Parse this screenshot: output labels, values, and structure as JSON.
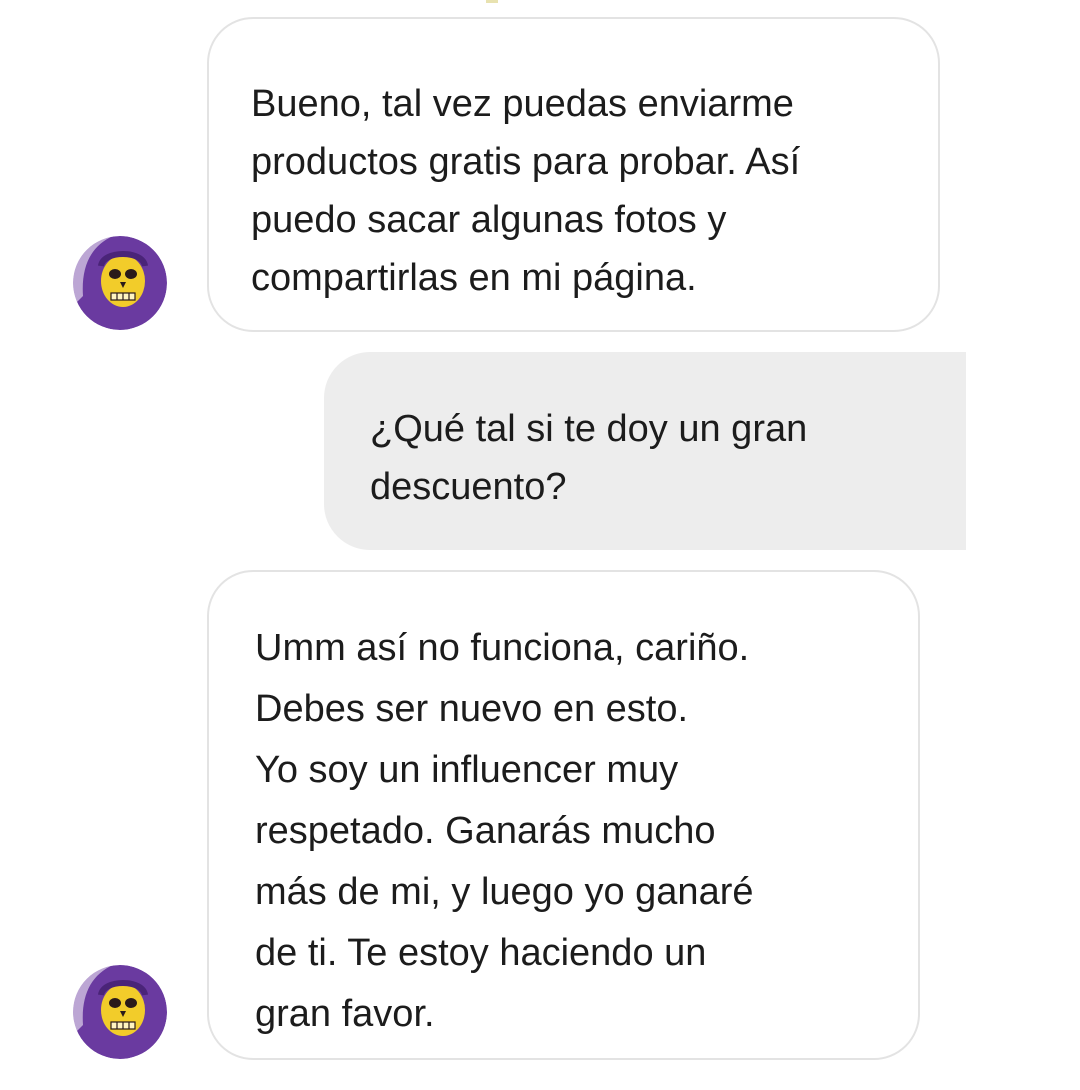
{
  "messages": [
    {
      "direction": "incoming",
      "text": "Bueno, tal vez puedas enviarme\nproductos gratis para probar. Así\npuedo sacar algunas fotos y\ncompartirlas en mi página."
    },
    {
      "direction": "outgoing",
      "text": "¿Qué tal si te doy un gran\ndescuento?"
    },
    {
      "direction": "incoming",
      "text": "Umm así no funciona, cariño.\nDebes ser nuevo en esto.\nYo soy un influencer muy\nrespetado. Ganarás mucho\nmás de mi, y luego yo ganaré\nde ti. Te estoy haciendo un\ngran favor."
    }
  ],
  "avatar": {
    "icon": "skull-hooded-avatar-icon",
    "hood_color": "#6a3aa0",
    "face_color": "#f2cc2a"
  },
  "colors": {
    "background": "#ffffff",
    "incoming_bubble": "#ffffff",
    "incoming_border": "#e3e3e3",
    "outgoing_bubble": "#ededed",
    "text": "#1c1c1c"
  }
}
